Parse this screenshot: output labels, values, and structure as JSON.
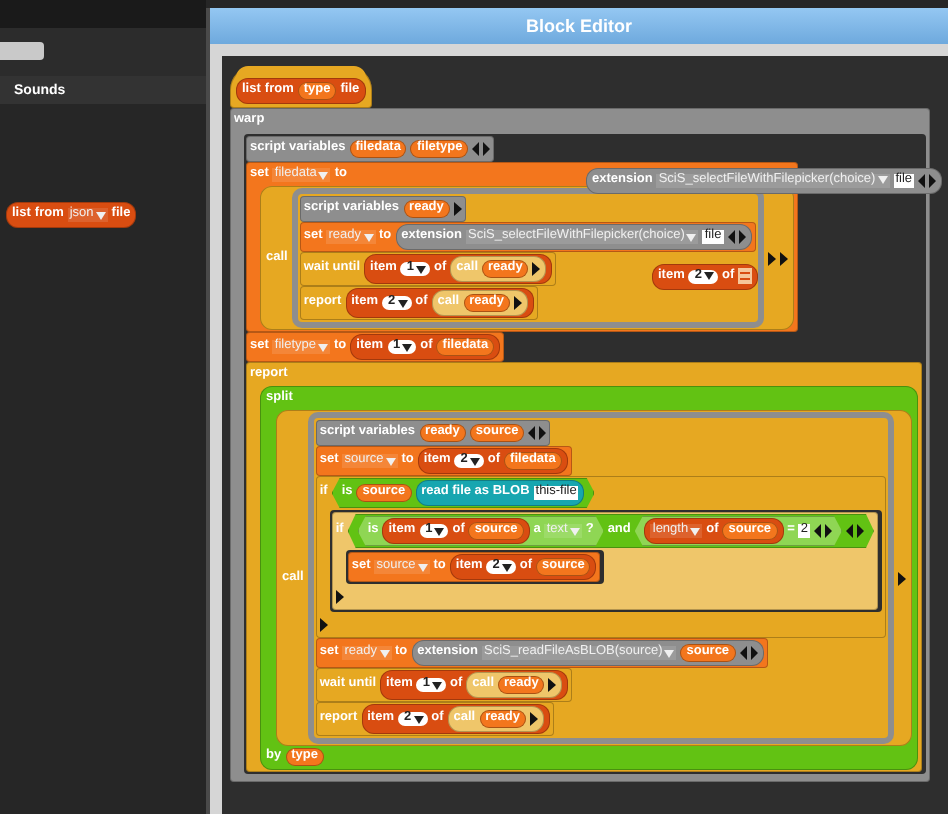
{
  "window": {
    "title": "Block Editor"
  },
  "sidebar": {
    "tabs": [
      {
        "label": "Sounds"
      }
    ],
    "palette": [
      {
        "kind": "reporter",
        "color": "#d94d11",
        "parts": [
          {
            "kind": "label",
            "text": "list"
          },
          {
            "kind": "label",
            "text": "from"
          },
          {
            "kind": "dropdown",
            "text": "json"
          },
          {
            "kind": "label",
            "text": "file"
          }
        ]
      }
    ]
  },
  "script": [
    {
      "kind": "hat",
      "color": "#e6a822",
      "parts": [
        {
          "kind": "reporter",
          "color": "#d94d11",
          "parts": [
            {
              "kind": "label",
              "text": "list"
            },
            {
              "kind": "label",
              "text": "from"
            },
            {
              "kind": "var",
              "text": "type"
            },
            {
              "kind": "label",
              "text": "file"
            }
          ]
        }
      ]
    },
    {
      "kind": "command",
      "color": "#8e8e8e",
      "parts": [
        {
          "kind": "label",
          "text": "warp"
        },
        {
          "kind": "script",
          "blocks": [
            {
              "kind": "command",
              "color": "#8e8e8e",
              "parts": [
                {
                  "kind": "label",
                  "text": "script variables"
                },
                {
                  "kind": "var",
                  "text": "filedata"
                },
                {
                  "kind": "var",
                  "text": "filetype"
                },
                {
                  "kind": "arrows"
                }
              ]
            },
            {
              "kind": "command",
              "color": "#f3761d",
              "parts": [
                {
                  "kind": "label",
                  "text": "set"
                },
                {
                  "kind": "dropdown",
                  "text": "filedata"
                },
                {
                  "kind": "label",
                  "text": "to"
                },
                {
                  "kind": "reporter",
                  "color": "#e6a822",
                  "parts": [
                    {
                      "kind": "label",
                      "text": "call"
                    },
                    {
                      "kind": "ring",
                      "blocks": [
                        {
                          "kind": "command",
                          "color": "#8e8e8e",
                          "parts": [
                            {
                              "kind": "label",
                              "text": "script variables"
                            },
                            {
                              "kind": "var",
                              "text": "ready"
                            },
                            {
                              "kind": "arrow"
                            }
                          ]
                        },
                        {
                          "kind": "command",
                          "color": "#f3761d",
                          "parts": [
                            {
                              "kind": "label",
                              "text": "set"
                            },
                            {
                              "kind": "dropdown",
                              "text": "ready"
                            },
                            {
                              "kind": "label",
                              "text": "to"
                            },
                            {
                              "kind": "reporter",
                              "color": "#8e8e8e",
                              "parts": [
                                {
                                  "kind": "label",
                                  "text": "extension"
                                },
                                {
                                  "kind": "dropdown",
                                  "text": "SciS_selectFileWithFilepicker(choice)"
                                },
                                {
                                  "kind": "text",
                                  "text": "file"
                                },
                                {
                                  "kind": "arrows"
                                }
                              ]
                            }
                          ]
                        },
                        {
                          "kind": "command",
                          "color": "#e6a822",
                          "parts": [
                            {
                              "kind": "label",
                              "text": "wait until"
                            },
                            {
                              "kind": "reporter",
                              "color": "#d94d11",
                              "parts": [
                                {
                                  "kind": "label",
                                  "text": "item"
                                },
                                {
                                  "kind": "num",
                                  "text": "1"
                                },
                                {
                                  "kind": "label",
                                  "text": "of"
                                },
                                {
                                  "kind": "reporter",
                                  "color": "#efc66a",
                                  "parts": [
                                    {
                                      "kind": "label",
                                      "text": "call"
                                    },
                                    {
                                      "kind": "var",
                                      "text": "ready"
                                    },
                                    {
                                      "kind": "arrow"
                                    }
                                  ]
                                }
                              ]
                            }
                          ]
                        },
                        {
                          "kind": "command",
                          "color": "#e6a822",
                          "parts": [
                            {
                              "kind": "label",
                              "text": "report"
                            },
                            {
                              "kind": "reporter",
                              "color": "#d94d11",
                              "parts": [
                                {
                                  "kind": "label",
                                  "text": "item"
                                },
                                {
                                  "kind": "num",
                                  "text": "2"
                                },
                                {
                                  "kind": "label",
                                  "text": "of"
                                },
                                {
                                  "kind": "reporter",
                                  "color": "#efc66a",
                                  "parts": [
                                    {
                                      "kind": "label",
                                      "text": "call"
                                    },
                                    {
                                      "kind": "var",
                                      "text": "ready"
                                    },
                                    {
                                      "kind": "arrow"
                                    }
                                  ]
                                }
                              ]
                            }
                          ]
                        }
                      ]
                    },
                    {
                      "kind": "arrow"
                    },
                    {
                      "kind": "arrow"
                    }
                  ]
                }
              ]
            },
            {
              "kind": "command",
              "color": "#f3761d",
              "parts": [
                {
                  "kind": "label",
                  "text": "set"
                },
                {
                  "kind": "dropdown",
                  "text": "filetype"
                },
                {
                  "kind": "label",
                  "text": "to"
                },
                {
                  "kind": "reporter",
                  "color": "#d94d11",
                  "parts": [
                    {
                      "kind": "label",
                      "text": "item"
                    },
                    {
                      "kind": "num",
                      "text": "1"
                    },
                    {
                      "kind": "label",
                      "text": "of"
                    },
                    {
                      "kind": "var",
                      "text": "filedata"
                    }
                  ]
                }
              ]
            },
            {
              "kind": "command",
              "color": "#e6a822",
              "parts": [
                {
                  "kind": "label",
                  "text": "report"
                },
                {
                  "kind": "reporter",
                  "color": "#62c213",
                  "parts": [
                    {
                      "kind": "label",
                      "text": "split"
                    },
                    {
                      "kind": "reporter",
                      "color": "#e6a822",
                      "parts": [
                        {
                          "kind": "label",
                          "text": "call"
                        },
                        {
                          "kind": "ring",
                          "blocks": [
                            {
                              "kind": "command",
                              "color": "#8e8e8e",
                              "parts": [
                                {
                                  "kind": "label",
                                  "text": "script variables"
                                },
                                {
                                  "kind": "var",
                                  "text": "ready"
                                },
                                {
                                  "kind": "var",
                                  "text": "source"
                                },
                                {
                                  "kind": "arrows"
                                }
                              ]
                            },
                            {
                              "kind": "command",
                              "color": "#f3761d",
                              "parts": [
                                {
                                  "kind": "label",
                                  "text": "set"
                                },
                                {
                                  "kind": "dropdown",
                                  "text": "source"
                                },
                                {
                                  "kind": "label",
                                  "text": "to"
                                },
                                {
                                  "kind": "reporter",
                                  "color": "#d94d11",
                                  "parts": [
                                    {
                                      "kind": "label",
                                      "text": "item"
                                    },
                                    {
                                      "kind": "num",
                                      "text": "2"
                                    },
                                    {
                                      "kind": "label",
                                      "text": "of"
                                    },
                                    {
                                      "kind": "var",
                                      "text": "filedata"
                                    }
                                  ]
                                }
                              ]
                            },
                            {
                              "kind": "command",
                              "color": "#e6a822",
                              "parts": [
                                {
                                  "kind": "label",
                                  "text": "if"
                                },
                                {
                                  "kind": "predicate",
                                  "color": "#62c213",
                                  "parts": [
                                    {
                                      "kind": "label",
                                      "text": "is"
                                    },
                                    {
                                      "kind": "var",
                                      "text": "source"
                                    },
                                    {
                                      "kind": "reporter",
                                      "color": "#17a6b0",
                                      "parts": [
                                        {
                                          "kind": "label",
                                          "text": "read file as BLOB"
                                        },
                                        {
                                          "kind": "text",
                                          "text": "this-file"
                                        }
                                      ]
                                    }
                                  ]
                                },
                                {
                                  "kind": "script",
                                  "blocks": [
                                    {
                                      "kind": "command",
                                      "color": "#efc66a",
                                      "parts": [
                                        {
                                          "kind": "label",
                                          "text": "if"
                                        },
                                        {
                                          "kind": "predicate",
                                          "color": "#62c213",
                                          "parts": [
                                            {
                                              "kind": "predicate",
                                              "color": "#8fd654",
                                              "parts": [
                                                {
                                                  "kind": "label",
                                                  "text": "is"
                                                },
                                                {
                                                  "kind": "reporter",
                                                  "color": "#d94d11",
                                                  "parts": [
                                                    {
                                                      "kind": "label",
                                                      "text": "item"
                                                    },
                                                    {
                                                      "kind": "num",
                                                      "text": "1"
                                                    },
                                                    {
                                                      "kind": "label",
                                                      "text": "of"
                                                    },
                                                    {
                                                      "kind": "var",
                                                      "text": "source"
                                                    }
                                                  ]
                                                },
                                                {
                                                  "kind": "label",
                                                  "text": "a"
                                                },
                                                {
                                                  "kind": "dropdown",
                                                  "text": "text"
                                                },
                                                {
                                                  "kind": "label",
                                                  "text": "?"
                                                }
                                              ]
                                            },
                                            {
                                              "kind": "label",
                                              "text": "and"
                                            },
                                            {
                                              "kind": "predicate",
                                              "color": "#8fd654",
                                              "parts": [
                                                {
                                                  "kind": "reporter",
                                                  "color": "#d94d11",
                                                  "parts": [
                                                    {
                                                      "kind": "dropdown",
                                                      "text": "length"
                                                    },
                                                    {
                                                      "kind": "label",
                                                      "text": "of"
                                                    },
                                                    {
                                                      "kind": "var",
                                                      "text": "source"
                                                    }
                                                  ]
                                                },
                                                {
                                                  "kind": "label",
                                                  "text": "="
                                                },
                                                {
                                                  "kind": "text",
                                                  "text": "2"
                                                },
                                                {
                                                  "kind": "arrows"
                                                }
                                              ]
                                            },
                                            {
                                              "kind": "arrows"
                                            }
                                          ]
                                        },
                                        {
                                          "kind": "script",
                                          "blocks": [
                                            {
                                              "kind": "command",
                                              "color": "#f3761d",
                                              "parts": [
                                                {
                                                  "kind": "label",
                                                  "text": "set"
                                                },
                                                {
                                                  "kind": "dropdown",
                                                  "text": "source"
                                                },
                                                {
                                                  "kind": "label",
                                                  "text": "to"
                                                },
                                                {
                                                  "kind": "reporter",
                                                  "color": "#d94d11",
                                                  "parts": [
                                                    {
                                                      "kind": "label",
                                                      "text": "item"
                                                    },
                                                    {
                                                      "kind": "num",
                                                      "text": "2"
                                                    },
                                                    {
                                                      "kind": "label",
                                                      "text": "of"
                                                    },
                                                    {
                                                      "kind": "var",
                                                      "text": "source"
                                                    }
                                                  ]
                                                }
                                              ]
                                            }
                                          ]
                                        },
                                        {
                                          "kind": "arrow"
                                        }
                                      ]
                                    }
                                  ]
                                },
                                {
                                  "kind": "arrow"
                                }
                              ]
                            },
                            {
                              "kind": "command",
                              "color": "#f3761d",
                              "parts": [
                                {
                                  "kind": "label",
                                  "text": "set"
                                },
                                {
                                  "kind": "dropdown",
                                  "text": "ready"
                                },
                                {
                                  "kind": "label",
                                  "text": "to"
                                },
                                {
                                  "kind": "reporter",
                                  "color": "#8e8e8e",
                                  "parts": [
                                    {
                                      "kind": "label",
                                      "text": "extension"
                                    },
                                    {
                                      "kind": "dropdown",
                                      "text": "SciS_readFileAsBLOB(source)"
                                    },
                                    {
                                      "kind": "var",
                                      "text": "source"
                                    },
                                    {
                                      "kind": "arrows"
                                    }
                                  ]
                                }
                              ]
                            },
                            {
                              "kind": "command",
                              "color": "#e6a822",
                              "parts": [
                                {
                                  "kind": "label",
                                  "text": "wait until"
                                },
                                {
                                  "kind": "reporter",
                                  "color": "#d94d11",
                                  "parts": [
                                    {
                                      "kind": "label",
                                      "text": "item"
                                    },
                                    {
                                      "kind": "num",
                                      "text": "1"
                                    },
                                    {
                                      "kind": "label",
                                      "text": "of"
                                    },
                                    {
                                      "kind": "reporter",
                                      "color": "#efc66a",
                                      "parts": [
                                        {
                                          "kind": "label",
                                          "text": "call"
                                        },
                                        {
                                          "kind": "var",
                                          "text": "ready"
                                        },
                                        {
                                          "kind": "arrow"
                                        }
                                      ]
                                    }
                                  ]
                                }
                              ]
                            },
                            {
                              "kind": "command",
                              "color": "#e6a822",
                              "parts": [
                                {
                                  "kind": "label",
                                  "text": "report"
                                },
                                {
                                  "kind": "reporter",
                                  "color": "#d94d11",
                                  "parts": [
                                    {
                                      "kind": "label",
                                      "text": "item"
                                    },
                                    {
                                      "kind": "num",
                                      "text": "2"
                                    },
                                    {
                                      "kind": "label",
                                      "text": "of"
                                    },
                                    {
                                      "kind": "reporter",
                                      "color": "#efc66a",
                                      "parts": [
                                        {
                                          "kind": "label",
                                          "text": "call"
                                        },
                                        {
                                          "kind": "var",
                                          "text": "ready"
                                        },
                                        {
                                          "kind": "arrow"
                                        }
                                      ]
                                    }
                                  ]
                                }
                              ]
                            }
                          ]
                        },
                        {
                          "kind": "arrow"
                        }
                      ]
                    },
                    {
                      "kind": "label",
                      "text": "by"
                    },
                    {
                      "kind": "var",
                      "text": "type"
                    }
                  ]
                }
              ]
            }
          ]
        }
      ]
    }
  ],
  "floating_blocks": [
    {
      "kind": "reporter",
      "color": "#8e8e8e",
      "parts": [
        {
          "kind": "label",
          "text": "extension"
        },
        {
          "kind": "dropdown",
          "text": "SciS_selectFileWithFilepicker(choice)"
        },
        {
          "kind": "text",
          "text": "file"
        },
        {
          "kind": "arrows"
        }
      ]
    },
    {
      "kind": "reporter",
      "color": "#d94d11",
      "parts": [
        {
          "kind": "label",
          "text": "item"
        },
        {
          "kind": "num",
          "text": "2"
        },
        {
          "kind": "label",
          "text": "of"
        },
        {
          "kind": "list-icon"
        }
      ]
    }
  ]
}
